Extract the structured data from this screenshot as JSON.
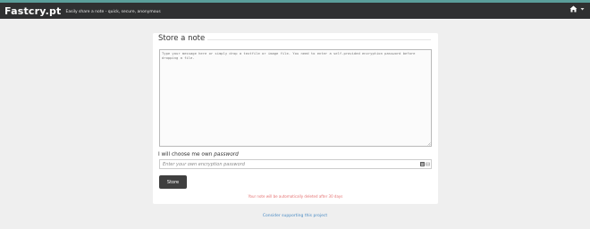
{
  "header": {
    "brand": "Fastcry.pt",
    "tagline": "Easily share a note - quick, secure, anonymous"
  },
  "form": {
    "title": "Store a note",
    "note_placeholder": "Type your message here or simply drop a textfile or image file. You need to enter a self-provided encryption password before dropping a file.",
    "password_label_prefix": "I will choose me own ",
    "password_label_emphasis": "password",
    "password_placeholder": "Enter your own encryption password",
    "store_label": "Store",
    "expire_message": "Your note will be automatically deleted after 30 days"
  },
  "footer": {
    "support_link": "Consider supporting this project"
  },
  "colors": {
    "navbar": "#2f3031",
    "accent": "#5a9e9a",
    "button": "#3f3f3f",
    "warning": "#e57373",
    "link": "#4a8bc4"
  },
  "icons": {
    "home": "home-icon",
    "caret": "caret-down-icon",
    "key": "password-manager-icon"
  }
}
